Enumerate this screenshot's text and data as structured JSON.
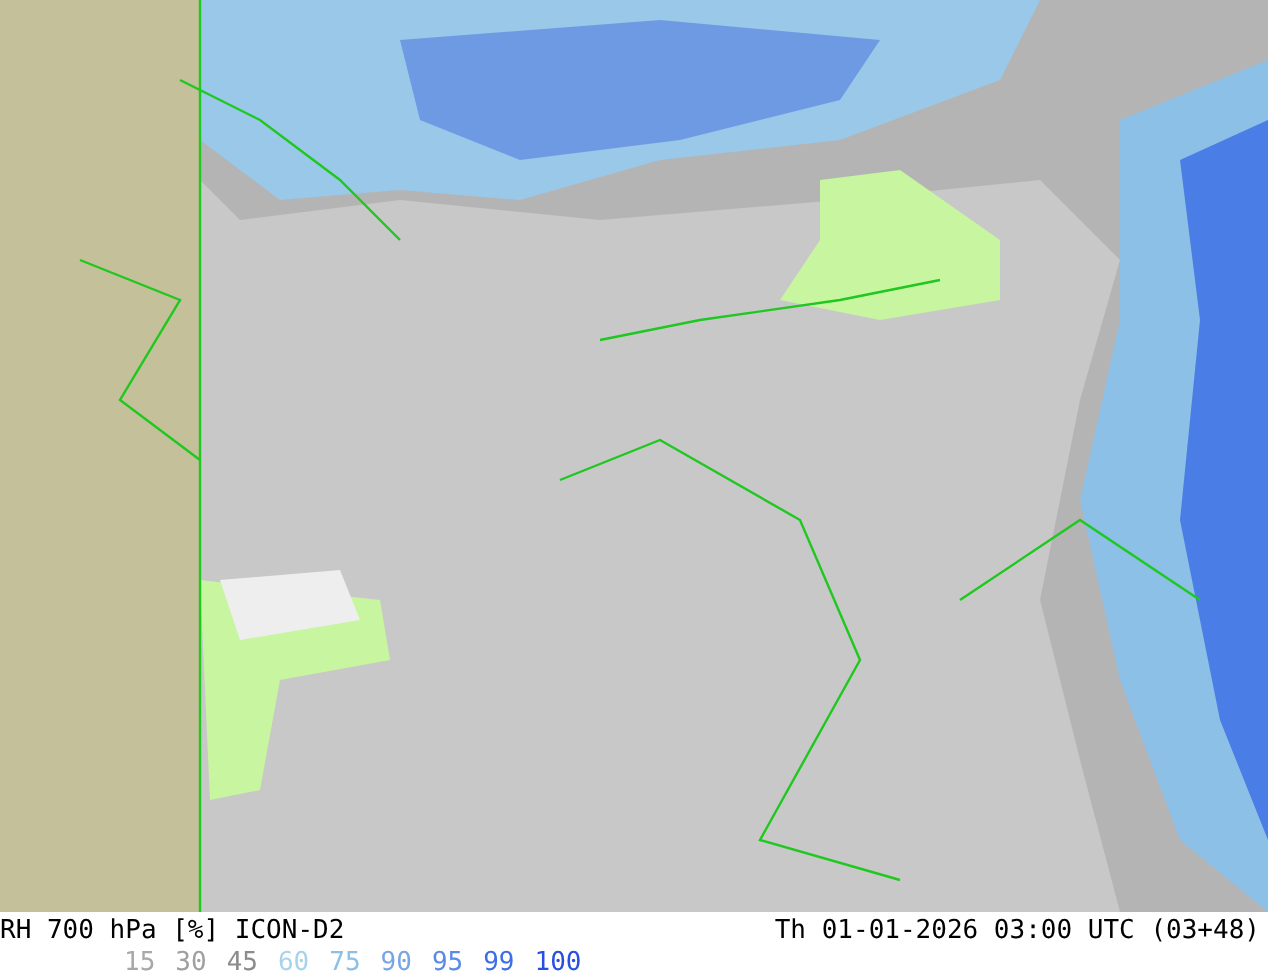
{
  "title": "RH 700 hPa [%] ICON-D2",
  "valid_time": "Th 01-01-2026 03:00 UTC (03+48)",
  "legend": [
    {
      "label": "15",
      "color": "#a8a8a8"
    },
    {
      "label": "30",
      "color": "#a0a0a0"
    },
    {
      "label": "45",
      "color": "#8c8c8c"
    },
    {
      "label": "60",
      "color": "#a6d4ec"
    },
    {
      "label": "75",
      "color": "#8cc0e6"
    },
    {
      "label": "90",
      "color": "#78a6e4"
    },
    {
      "label": "95",
      "color": "#5a8ae6"
    },
    {
      "label": "99",
      "color": "#3c6ee6"
    },
    {
      "label": "100",
      "color": "#2850e0"
    }
  ]
}
